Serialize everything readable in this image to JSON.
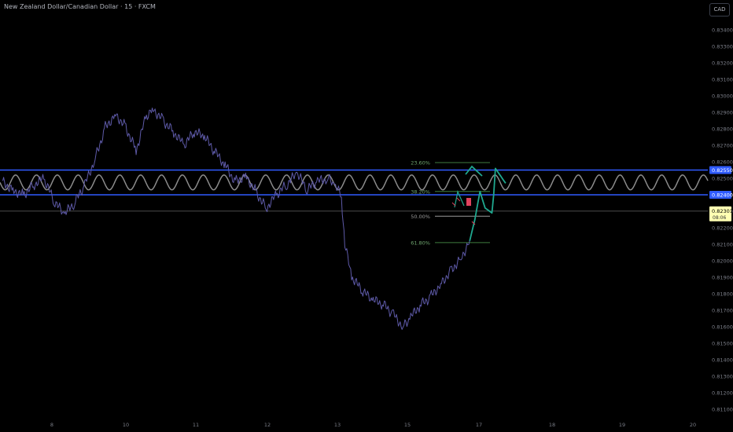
{
  "title": "New Zealand Dollar/Canadian Dollar · 15 · FXCM",
  "currency_button": "CAD",
  "colors": {
    "background": "#000000",
    "price_line": "#5e5aa8",
    "level_line": "#2f5bff",
    "wave": "#8c8c8c",
    "fib_line": "#3f7d3f",
    "projection": "#1fa88f",
    "marker": "#e0435e",
    "axis_text": "#7a7d87",
    "last_label_bg": "#ffffb3"
  },
  "price_axis": {
    "ticks": [
      "0.83400",
      "0.83300",
      "0.83200",
      "0.83100",
      "0.83000",
      "0.82900",
      "0.82800",
      "0.82700",
      "0.82600",
      "0.82500",
      "0.82400",
      "0.82300",
      "0.82200",
      "0.82100",
      "0.82000",
      "0.81900",
      "0.81800",
      "0.81700",
      "0.81600",
      "0.81500",
      "0.81400",
      "0.81300",
      "0.81200",
      "0.81100"
    ],
    "level_labels": [
      "0.82550",
      "0.82400"
    ],
    "last_price": "0.82301",
    "countdown": "08:06"
  },
  "time_axis": {
    "ticks": [
      "8",
      "10",
      "11",
      "12",
      "13",
      "15",
      "17",
      "18",
      "19",
      "20"
    ]
  },
  "fib_levels": [
    {
      "label": "23.60%",
      "price": 0.82595
    },
    {
      "label": "38.20%",
      "price": 0.8242
    },
    {
      "label": "50.00%",
      "price": 0.8227
    },
    {
      "label": "61.80%",
      "price": 0.8211
    }
  ],
  "horizontal_levels": [
    0.8255,
    0.824,
    0.82301
  ],
  "chart_data": {
    "type": "line",
    "title": "New Zealand Dollar/Canadian Dollar · 15 · FXCM",
    "ylim": [
      0.8105,
      0.8345
    ],
    "x_ticks": [
      "8",
      "10",
      "11",
      "12",
      "13",
      "15",
      "17",
      "18",
      "19",
      "20"
    ],
    "series": [
      {
        "name": "",
        "points": [
          [
            6.7,
            0.8248
          ],
          [
            7.0,
            0.8243
          ],
          [
            7.3,
            0.824
          ],
          [
            7.6,
            0.8246
          ],
          [
            7.9,
            0.825
          ],
          [
            8.2,
            0.8236
          ],
          [
            8.5,
            0.8228
          ],
          [
            8.8,
            0.8235
          ],
          [
            9.1,
            0.8246
          ],
          [
            9.4,
            0.8262
          ],
          [
            9.7,
            0.8281
          ],
          [
            10.0,
            0.8289
          ],
          [
            10.3,
            0.8281
          ],
          [
            10.6,
            0.8267
          ],
          [
            10.9,
            0.8288
          ],
          [
            11.1,
            0.8292
          ],
          [
            11.4,
            0.8285
          ],
          [
            11.7,
            0.8278
          ],
          [
            12.0,
            0.827
          ],
          [
            12.3,
            0.8278
          ],
          [
            12.6,
            0.8275
          ],
          [
            12.9,
            0.8266
          ],
          [
            13.2,
            0.8258
          ],
          [
            13.5,
            0.8248
          ],
          [
            13.8,
            0.8252
          ],
          [
            14.1,
            0.8242
          ],
          [
            14.4,
            0.8232
          ],
          [
            14.7,
            0.824
          ],
          [
            15.0,
            0.8246
          ],
          [
            15.3,
            0.8253
          ],
          [
            15.6,
            0.8243
          ],
          [
            15.9,
            0.8248
          ],
          [
            16.2,
            0.825
          ],
          [
            16.4,
            0.8246
          ],
          [
            16.6,
            0.8239
          ],
          [
            16.7,
            0.821
          ],
          [
            16.9,
            0.819
          ],
          [
            17.2,
            0.8182
          ],
          [
            17.5,
            0.8176
          ],
          [
            17.8,
            0.8174
          ],
          [
            18.1,
            0.8168
          ],
          [
            18.4,
            0.816
          ],
          [
            18.6,
            0.8165
          ],
          [
            18.9,
            0.8173
          ],
          [
            19.2,
            0.8178
          ],
          [
            19.5,
            0.8186
          ],
          [
            19.8,
            0.8194
          ],
          [
            20.1,
            0.8202
          ],
          [
            20.35,
            0.8212
          ]
        ]
      },
      {
        "name": "",
        "points": [
          [
            20.35,
            0.8212
          ],
          [
            20.5,
            0.8225
          ],
          [
            20.65,
            0.8242
          ],
          [
            20.8,
            0.8232
          ],
          [
            21.0,
            0.8229
          ],
          [
            21.05,
            0.824
          ],
          [
            21.1,
            0.8256
          ],
          [
            21.4,
            0.8247
          ]
        ]
      }
    ],
    "wave_center": 0.82475,
    "wave_amplitude": 0.00045
  }
}
